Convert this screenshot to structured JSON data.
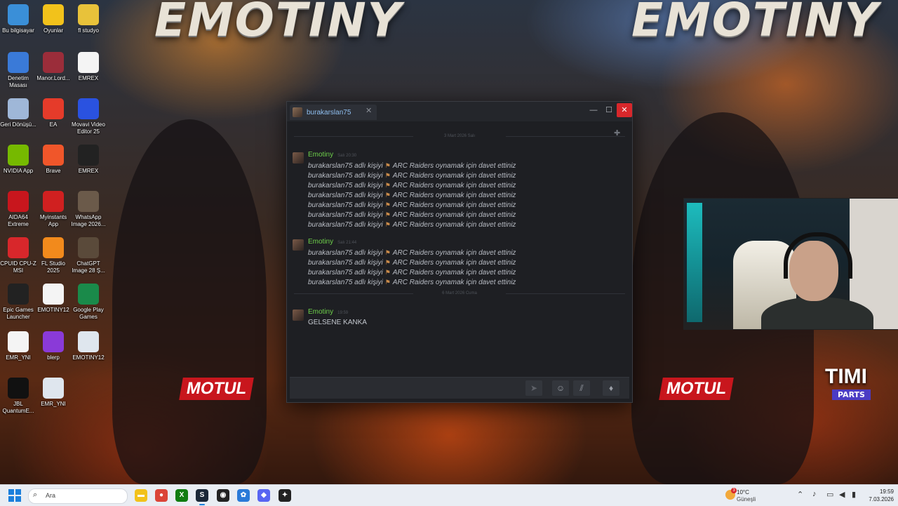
{
  "wallpaper": {
    "title_left": "EMOTINY",
    "title_right": "EMOTINY",
    "motul": "MOTUL",
    "timi": "TIMI",
    "parts": "PARTS"
  },
  "desktop_icons": [
    {
      "label": "Bu bilgisayar",
      "icon": "computer-icon",
      "color": "#3a8fd8"
    },
    {
      "label": "Oyunlar",
      "icon": "star-icon",
      "color": "#f2c21b"
    },
    {
      "label": "fl studyo",
      "icon": "folder-icon",
      "color": "#e8c23a"
    },
    {
      "label": "Denetim Masası",
      "icon": "control-panel-icon",
      "color": "#3a7ad8"
    },
    {
      "label": "Manor.Lord...",
      "icon": "archive-icon",
      "color": "#9b2d3a"
    },
    {
      "label": "EMREX",
      "icon": "video-file-icon",
      "color": "#f4f4f4"
    },
    {
      "label": "Geri Dönüşü...",
      "icon": "recycle-bin-icon",
      "color": "#9fb7d8"
    },
    {
      "label": "EA",
      "icon": "ea-icon",
      "color": "#e53b2a"
    },
    {
      "label": "Movavi Video Editor 25",
      "icon": "movavi-icon",
      "color": "#2a52e0"
    },
    {
      "label": "NVIDIA App",
      "icon": "nvidia-icon",
      "color": "#76b900"
    },
    {
      "label": "Brave",
      "icon": "brave-icon",
      "color": "#f0562a"
    },
    {
      "label": "EMREX",
      "icon": "video-file-icon",
      "color": "#222222"
    },
    {
      "label": "AIDA64 Extreme",
      "icon": "aida64-icon",
      "color": "#c8161d"
    },
    {
      "label": "Myinstants App",
      "icon": "myinstants-icon",
      "color": "#d02020"
    },
    {
      "label": "WhatsApp Image 2026...",
      "icon": "image-file-icon",
      "color": "#6b5a4a"
    },
    {
      "label": "CPUID CPU-Z MSI",
      "icon": "cpuz-icon",
      "color": "#d8272b"
    },
    {
      "label": "FL Studio 2025",
      "icon": "fl-studio-icon",
      "color": "#f28a1c"
    },
    {
      "label": "ChatGPT Image 28 Ş...",
      "icon": "image-file-icon",
      "color": "#5a4a3a"
    },
    {
      "label": "Epic Games Launcher",
      "icon": "epic-games-icon",
      "color": "#222222"
    },
    {
      "label": "EMOTINY12",
      "icon": "video-file-icon",
      "color": "#f4f4f4"
    },
    {
      "label": "Google Play Games",
      "icon": "google-play-icon",
      "color": "#1a8a4a"
    },
    {
      "label": "EMR_YNI",
      "icon": "video-file-icon",
      "color": "#f4f4f4"
    },
    {
      "label": "blerp",
      "icon": "blerp-icon",
      "color": "#8a3ad8"
    },
    {
      "label": "EMOTINY12",
      "icon": "document-icon",
      "color": "#dfe6ee"
    },
    {
      "label": "JBL QuantumE...",
      "icon": "jbl-icon",
      "color": "#111111"
    },
    {
      "label": "EMR_YNI",
      "icon": "document-icon",
      "color": "#dfe6ee"
    }
  ],
  "chat": {
    "tab_name": "burakarslan75",
    "window_buttons": {
      "min": "—",
      "max": "☐",
      "close": "✕"
    },
    "date_sep_1": "3 Mart 2026 Salı",
    "date_sep_2": "6 Mart 2026 Cuma",
    "invite_prefix": "burakarslan75 adlı kişiyi",
    "invite_suffix": "ARC Raiders oynamak için davet ettiniz",
    "groups": [
      {
        "author": "Emotiny",
        "time": "Salı 20:30",
        "lines": 7
      },
      {
        "author": "Emotiny",
        "time": "Salı 21:44",
        "lines": 4
      },
      {
        "author": "Emotiny",
        "time": "19:59",
        "text": "GELSENE KANKA"
      }
    ],
    "composer_placeholder": ""
  },
  "taskbar": {
    "search_placeholder": "Ara",
    "weather_temp": "10°C",
    "weather_cond": "Güneşli",
    "weather_badge": "3",
    "time": "19:59",
    "date": "7.03.2026",
    "apps": [
      {
        "name": "file-explorer",
        "color": "#f2c21b",
        "glyph": "▬"
      },
      {
        "name": "chrome",
        "color": "#db4437",
        "glyph": "●"
      },
      {
        "name": "xbox",
        "color": "#107c10",
        "glyph": "X"
      },
      {
        "name": "steam",
        "color": "#1b2838",
        "glyph": "S"
      },
      {
        "name": "obs",
        "color": "#222222",
        "glyph": "◉"
      },
      {
        "name": "settings-app",
        "color": "#2a7ad8",
        "glyph": "✿"
      },
      {
        "name": "discord",
        "color": "#5865f2",
        "glyph": "◆"
      },
      {
        "name": "other-app",
        "color": "#222222",
        "glyph": "✦"
      }
    ]
  }
}
